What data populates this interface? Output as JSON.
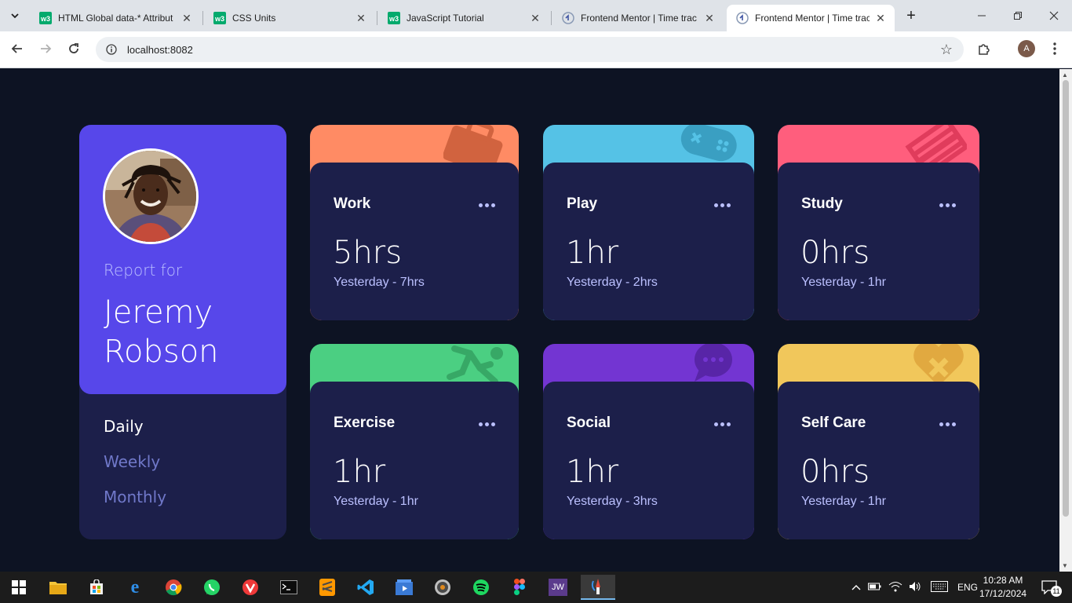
{
  "browser": {
    "tabs": [
      {
        "title": "HTML Global data-* Attribut",
        "icon": "w3schools-icon",
        "active": false
      },
      {
        "title": "CSS Units",
        "icon": "w3schools-icon",
        "active": false
      },
      {
        "title": "JavaScript Tutorial",
        "icon": "w3schools-icon",
        "active": false
      },
      {
        "title": "Frontend Mentor | Time trac",
        "icon": "frontend-mentor-icon",
        "active": false
      },
      {
        "title": "Frontend Mentor | Time trac",
        "icon": "frontend-mentor-icon",
        "active": true
      }
    ],
    "url": "localhost:8082",
    "profile_initial": "A"
  },
  "page": {
    "profile": {
      "report_for": "Report for",
      "name": "Jeremy Robson"
    },
    "periods": [
      {
        "label": "Daily",
        "active": true
      },
      {
        "label": "Weekly",
        "active": false
      },
      {
        "label": "Monthly",
        "active": false
      }
    ],
    "activities": [
      {
        "title": "Work",
        "current": "5hrs",
        "previous": "Yesterday - 7hrs",
        "color": "#ff8b64",
        "icon": "briefcase-icon"
      },
      {
        "title": "Play",
        "current": "1hr",
        "previous": "Yesterday - 2hrs",
        "color": "#55c2e6",
        "icon": "gamepad-icon"
      },
      {
        "title": "Study",
        "current": "0hrs",
        "previous": "Yesterday - 1hr",
        "color": "#ff5e7d",
        "icon": "book-icon"
      },
      {
        "title": "Exercise",
        "current": "1hr",
        "previous": "Yesterday - 1hr",
        "color": "#4bcf82",
        "icon": "runner-icon"
      },
      {
        "title": "Social",
        "current": "1hr",
        "previous": "Yesterday - 3hrs",
        "color": "#7335d2",
        "icon": "chat-bubble-icon"
      },
      {
        "title": "Self Care",
        "current": "0hrs",
        "previous": "Yesterday - 1hr",
        "color": "#f1c75b",
        "icon": "heart-plus-icon"
      }
    ],
    "colors": {
      "page_bg": "#0d1323",
      "card_bg": "#1c1f4a",
      "profile_bg": "#5747ea",
      "muted_text": "#bbc0ff",
      "period_text": "#7078c9"
    }
  },
  "taskbar": {
    "apps": [
      "file-explorer-icon",
      "microsoft-store-icon",
      "edge-icon",
      "chrome-icon",
      "whatsapp-icon",
      "vivaldi-icon",
      "terminal-icon",
      "sublime-text-icon",
      "vscode-icon",
      "media-player-icon",
      "cd-icon",
      "spotify-icon",
      "figma-icon",
      "jw-icon",
      "paint-icon"
    ],
    "language": "ENG",
    "time": "10:28 AM",
    "date": "17/12/2024",
    "notification_count": "11"
  }
}
